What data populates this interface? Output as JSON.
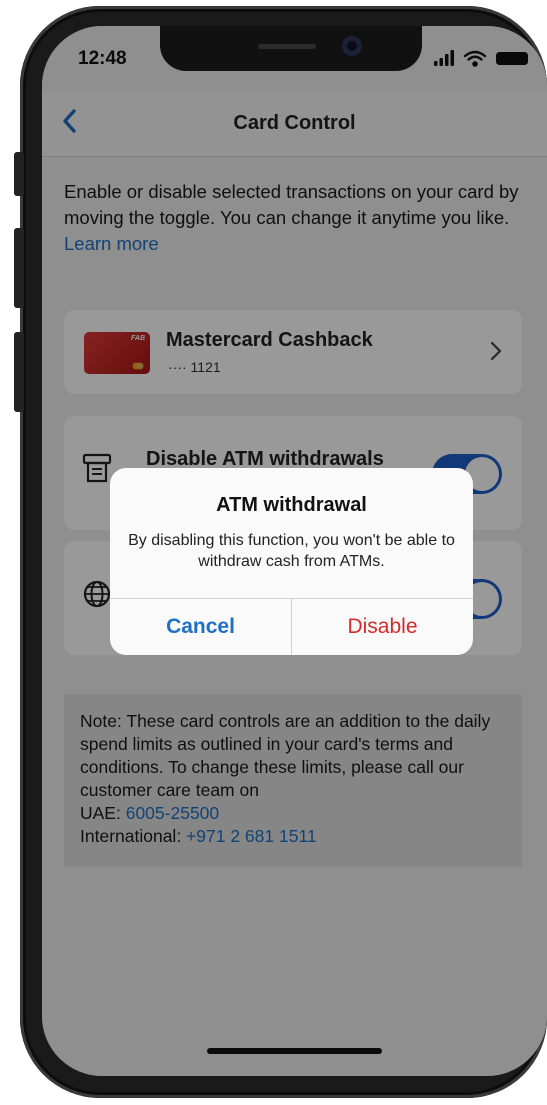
{
  "status_bar": {
    "time": "12:48"
  },
  "navbar": {
    "title": "Card Control"
  },
  "intro": {
    "text": "Enable or disable selected transactions on your card by moving the toggle. You can change it anytime you like.",
    "link": "Learn more"
  },
  "card": {
    "name": "Mastercard Cashback",
    "number": "···· 1121",
    "brand": "FAB"
  },
  "toggles": [
    {
      "label": "Disable ATM withdrawals",
      "on": true
    },
    {
      "label": "",
      "on": true
    }
  ],
  "note": {
    "text": "Note: These card controls are an addition to the daily spend limits as outlined in your card's terms and conditions. To change these limits, please call our customer care team on",
    "uae_label": "UAE: ",
    "uae_number": "6005-25500",
    "intl_label": "International: ",
    "intl_number": "+971 2 681 1511"
  },
  "alert": {
    "title": "ATM withdrawal",
    "message": "By disabling this function, you won't be able to withdraw cash from ATMs.",
    "cancel_label": "Cancel",
    "disable_label": "Disable"
  },
  "colors": {
    "accent": "#1f6fc4",
    "toggle_on": "#1d5ec9",
    "danger": "#d42b2b"
  }
}
